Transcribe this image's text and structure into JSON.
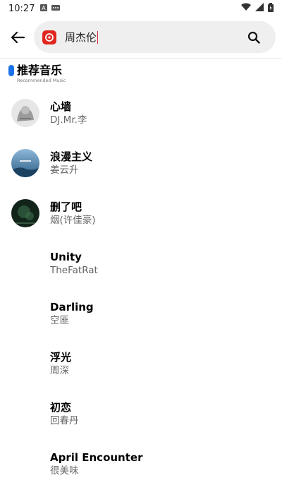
{
  "status": {
    "time": "10:27"
  },
  "search": {
    "query": "周杰伦"
  },
  "section": {
    "title": "推荐音乐",
    "subtitle": "Recommended Music"
  },
  "songs": [
    {
      "title": "心墙",
      "artist": "DJ.Mr.李",
      "cover": "gray-sketch"
    },
    {
      "title": "浪漫主义",
      "artist": "姜云升",
      "cover": "blue-sky"
    },
    {
      "title": "删了吧",
      "artist": "烟(许佳豪)",
      "cover": "dark-green"
    },
    {
      "title": "Unity",
      "artist": "TheFatRat",
      "cover": "none"
    },
    {
      "title": "Darling",
      "artist": "空匪",
      "cover": "none"
    },
    {
      "title": "浮光",
      "artist": "周深",
      "cover": "none"
    },
    {
      "title": "初恋",
      "artist": "回春丹",
      "cover": "none"
    },
    {
      "title": "April Encounter",
      "artist": "很美味",
      "cover": "none"
    }
  ]
}
